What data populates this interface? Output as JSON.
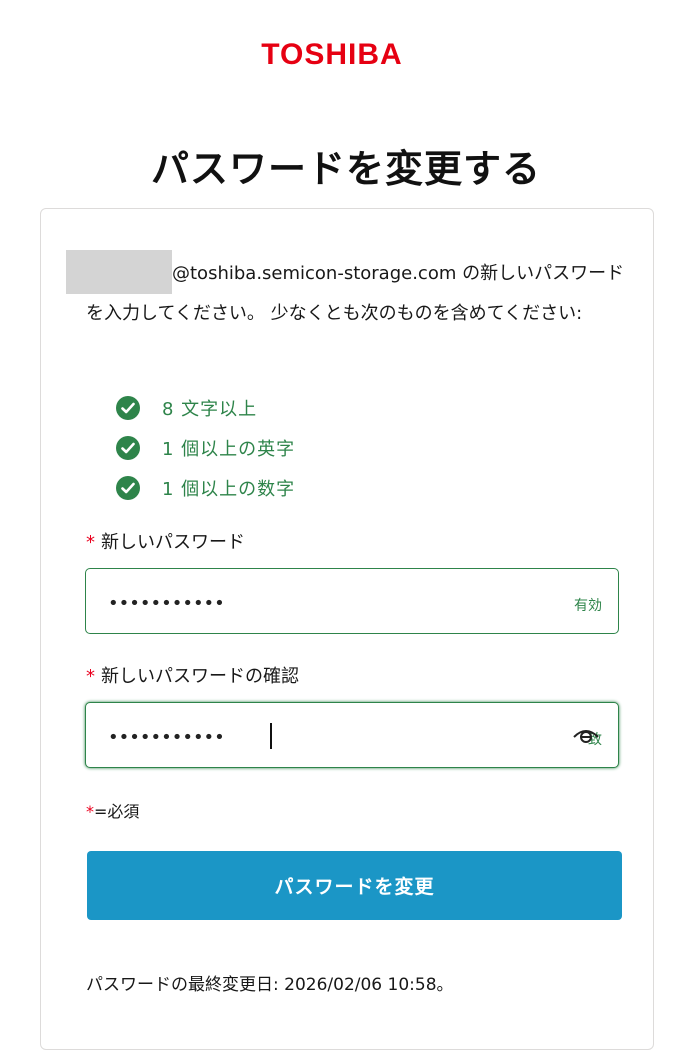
{
  "brand": {
    "logo_text": "TOSHIBA",
    "logo_color": "#e60012"
  },
  "page": {
    "title": "パスワードを変更する"
  },
  "intro": {
    "email_domain": "@toshiba.semicon-storage.com",
    "message": " の新しいパスワードを入力してください。 少なくとも次のものを含めてください:"
  },
  "requirements": [
    {
      "text": "8 文字以上",
      "icon": "check-circle-icon",
      "status": "met"
    },
    {
      "text": "1 個以上の英字",
      "icon": "check-circle-icon",
      "status": "met"
    },
    {
      "text": "1 個以上の数字",
      "icon": "check-circle-icon",
      "status": "met"
    }
  ],
  "form": {
    "new_password": {
      "required_mark": "*",
      "label": "新しいパスワード",
      "value": "•••••••••••",
      "status_text": "有効"
    },
    "confirm_password": {
      "required_mark": "*",
      "label": "新しいパスワードの確認",
      "value": "•••••••••••",
      "status_text": "致",
      "icon": "eye-icon"
    },
    "required_note_mark": "*",
    "required_note_text": "=必須",
    "submit_label": "パスワードを変更"
  },
  "footer": {
    "last_changed": "パスワードの最終変更日: 2026/02/06 10:58。"
  },
  "colors": {
    "success": "#2e844a",
    "primary_button": "#1b96c6",
    "required": "#ea001e"
  }
}
